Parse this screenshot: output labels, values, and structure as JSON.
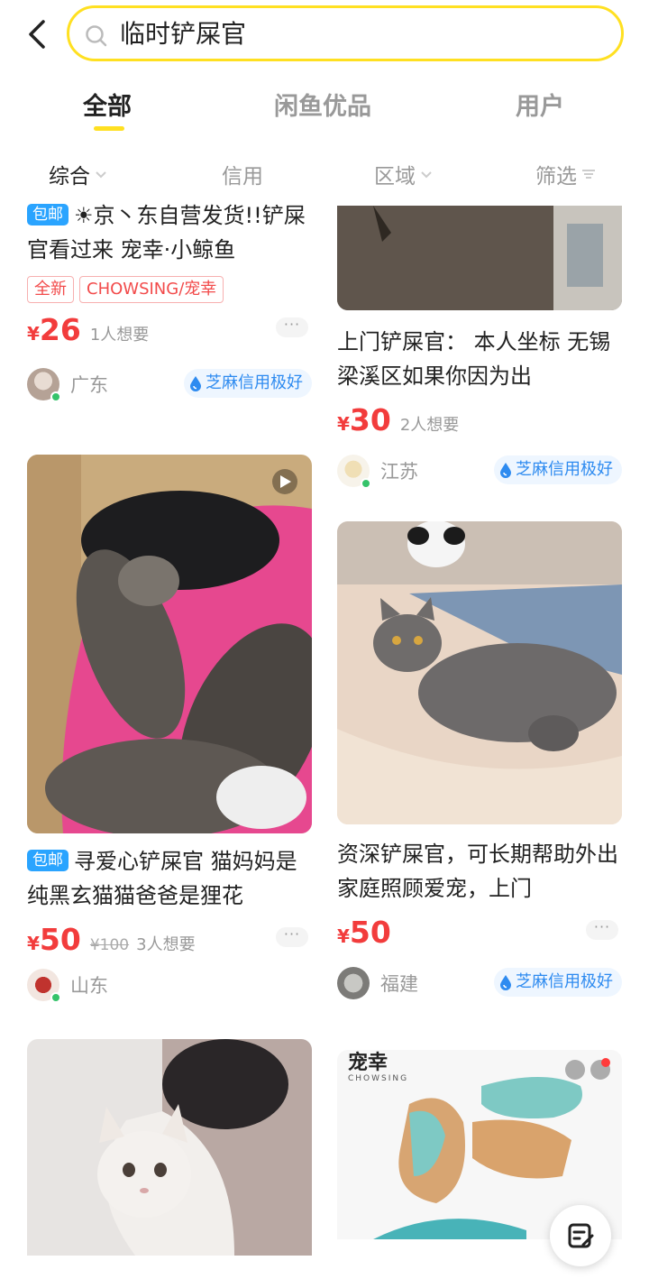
{
  "header": {
    "search_query": "临时铲屎官"
  },
  "tabs": [
    {
      "label": "全部",
      "active": true
    },
    {
      "label": "闲鱼优品",
      "active": false
    },
    {
      "label": "用户",
      "active": false
    }
  ],
  "filters": [
    {
      "label": "综合",
      "icon": "chevron-down-icon",
      "active": true
    },
    {
      "label": "信用",
      "icon": "",
      "active": false
    },
    {
      "label": "区域",
      "icon": "chevron-down-icon",
      "active": false
    },
    {
      "label": "筛选",
      "icon": "filter-icon",
      "active": false
    }
  ],
  "items": {
    "item1": {
      "badge": "包邮",
      "title": "☀京丶东自营发货!!铲屎官看过来 宠幸·小鲸鱼",
      "tags": [
        "全新",
        "CHOWSING/宠幸"
      ],
      "price_symbol": "¥",
      "price": "26",
      "wants": "1人想要",
      "region": "广东",
      "credit": "芝麻信用极好"
    },
    "item2": {
      "title": "上门铲屎官： 本人坐标 无锡梁溪区如果你因为出",
      "price_symbol": "¥",
      "price": "30",
      "wants": "2人想要",
      "region": "江苏",
      "credit": "芝麻信用极好"
    },
    "item3": {
      "badge": "包邮",
      "title": "寻爱心铲屎官 猫妈妈是纯黑玄猫猫爸爸是狸花",
      "price_symbol": "¥",
      "price": "50",
      "original_price": "¥100",
      "wants": "3人想要",
      "region": "山东"
    },
    "item4": {
      "title": "资深铲屎官，可长期帮助外出家庭照顾爱宠，上门",
      "price_symbol": "¥",
      "price": "50",
      "region": "福建",
      "credit": "芝麻信用极好"
    },
    "item6": {
      "brand_logo_text": "宠幸",
      "brand_logo_sub": "CHOWSING"
    }
  },
  "colors": {
    "accent_yellow": "#ffe021",
    "price_red": "#f23c3c",
    "credit_blue": "#2e8bf0",
    "ship_blue": "#2aa4ff"
  }
}
